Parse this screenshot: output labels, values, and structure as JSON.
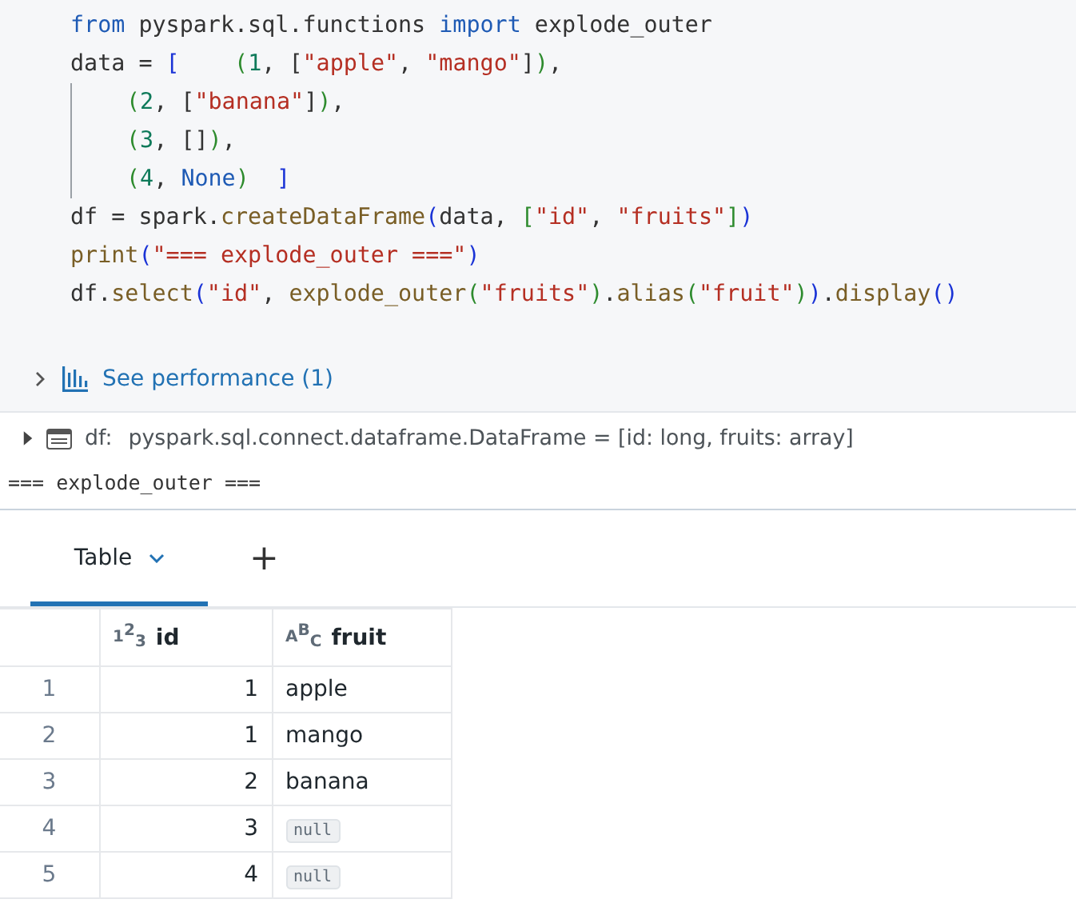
{
  "code": {
    "lines": [
      {
        "guide": false,
        "tokens": [
          {
            "kind": "kw",
            "text": "from"
          },
          {
            "kind": "plain",
            "text": " pyspark.sql.functions "
          },
          {
            "kind": "kw",
            "text": "import"
          },
          {
            "kind": "plain",
            "text": " explode_outer"
          }
        ]
      },
      {
        "guide": false,
        "tokens": [
          {
            "kind": "plain",
            "text": "data = "
          },
          {
            "kind": "b1",
            "text": "[    "
          },
          {
            "kind": "b2",
            "text": "("
          },
          {
            "kind": "num",
            "text": "1"
          },
          {
            "kind": "plain",
            "text": ", ["
          },
          {
            "kind": "str",
            "text": "\"apple\""
          },
          {
            "kind": "plain",
            "text": ", "
          },
          {
            "kind": "str",
            "text": "\"mango\""
          },
          {
            "kind": "plain",
            "text": "]"
          },
          {
            "kind": "b2",
            "text": ")"
          },
          {
            "kind": "plain",
            "text": ","
          }
        ]
      },
      {
        "guide": true,
        "tokens": [
          {
            "kind": "b2",
            "text": "("
          },
          {
            "kind": "num",
            "text": "2"
          },
          {
            "kind": "plain",
            "text": ", ["
          },
          {
            "kind": "str",
            "text": "\"banana\""
          },
          {
            "kind": "plain",
            "text": "]"
          },
          {
            "kind": "b2",
            "text": ")"
          },
          {
            "kind": "plain",
            "text": ","
          }
        ]
      },
      {
        "guide": true,
        "tokens": [
          {
            "kind": "b2",
            "text": "("
          },
          {
            "kind": "num",
            "text": "3"
          },
          {
            "kind": "plain",
            "text": ", []"
          },
          {
            "kind": "b2",
            "text": ")"
          },
          {
            "kind": "plain",
            "text": ","
          }
        ]
      },
      {
        "guide": true,
        "tokens": [
          {
            "kind": "b2",
            "text": "("
          },
          {
            "kind": "num",
            "text": "4"
          },
          {
            "kind": "plain",
            "text": ", "
          },
          {
            "kind": "kw",
            "text": "None"
          },
          {
            "kind": "b2",
            "text": ")  "
          },
          {
            "kind": "b1",
            "text": "]"
          }
        ]
      },
      {
        "guide": false,
        "tokens": [
          {
            "kind": "plain",
            "text": "df = spark."
          },
          {
            "kind": "fn",
            "text": "createDataFrame"
          },
          {
            "kind": "b1",
            "text": "("
          },
          {
            "kind": "plain",
            "text": "data, "
          },
          {
            "kind": "b2",
            "text": "["
          },
          {
            "kind": "str",
            "text": "\"id\""
          },
          {
            "kind": "plain",
            "text": ", "
          },
          {
            "kind": "str",
            "text": "\"fruits\""
          },
          {
            "kind": "b2",
            "text": "]"
          },
          {
            "kind": "b1",
            "text": ")"
          }
        ]
      },
      {
        "guide": false,
        "tokens": [
          {
            "kind": "fn",
            "text": "print"
          },
          {
            "kind": "b1",
            "text": "("
          },
          {
            "kind": "str",
            "text": "\"=== explode_outer ===\""
          },
          {
            "kind": "b1",
            "text": ")"
          }
        ]
      },
      {
        "guide": false,
        "tokens": [
          {
            "kind": "plain",
            "text": "df."
          },
          {
            "kind": "fn",
            "text": "select"
          },
          {
            "kind": "b1",
            "text": "("
          },
          {
            "kind": "str",
            "text": "\"id\""
          },
          {
            "kind": "plain",
            "text": ", "
          },
          {
            "kind": "fn",
            "text": "explode_outer"
          },
          {
            "kind": "b2",
            "text": "("
          },
          {
            "kind": "str",
            "text": "\"fruits\""
          },
          {
            "kind": "b2",
            "text": ")"
          },
          {
            "kind": "plain",
            "text": "."
          },
          {
            "kind": "fn",
            "text": "alias"
          },
          {
            "kind": "b2",
            "text": "("
          },
          {
            "kind": "str",
            "text": "\"fruit\""
          },
          {
            "kind": "b2",
            "text": ")"
          },
          {
            "kind": "b1",
            "text": ")"
          },
          {
            "kind": "plain",
            "text": "."
          },
          {
            "kind": "fn",
            "text": "display"
          },
          {
            "kind": "b1",
            "text": "()"
          }
        ]
      }
    ]
  },
  "performance": {
    "expanded": false,
    "label": "See performance (1)"
  },
  "dataframe": {
    "expanded": false,
    "name": "df:",
    "schema": "pyspark.sql.connect.dataframe.DataFrame = [id: long, fruits: array]"
  },
  "stdout": "=== explode_outer ===",
  "result_tabs": [
    {
      "label": "Table",
      "selected": true
    }
  ],
  "add_tab": "+",
  "table": {
    "columns": [
      {
        "type_icon": [
          "1",
          "2",
          "3"
        ],
        "label": "id"
      },
      {
        "type_icon": [
          "A",
          "B",
          "C"
        ],
        "label": "fruit"
      }
    ],
    "rows": [
      {
        "index": "1",
        "cells": [
          {
            "kind": "value",
            "text": "1"
          },
          {
            "kind": "value",
            "text": "apple"
          }
        ]
      },
      {
        "index": "2",
        "cells": [
          {
            "kind": "value",
            "text": "1"
          },
          {
            "kind": "value",
            "text": "mango"
          }
        ]
      },
      {
        "index": "3",
        "cells": [
          {
            "kind": "value",
            "text": "2"
          },
          {
            "kind": "value",
            "text": "banana"
          }
        ]
      },
      {
        "index": "4",
        "cells": [
          {
            "kind": "value",
            "text": "3"
          },
          {
            "kind": "null",
            "text": "null"
          }
        ]
      },
      {
        "index": "5",
        "cells": [
          {
            "kind": "value",
            "text": "4"
          },
          {
            "kind": "null",
            "text": "null"
          }
        ]
      }
    ]
  }
}
